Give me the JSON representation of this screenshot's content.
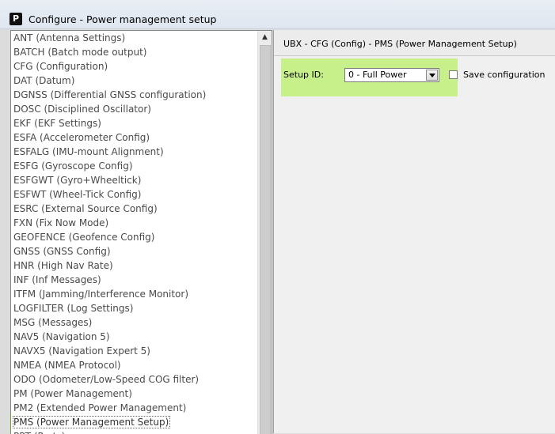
{
  "window": {
    "app_icon_letter": "P",
    "title": "Configure - Power management setup"
  },
  "message_list": {
    "items": [
      "ANT (Antenna Settings)",
      "BATCH (Batch mode output)",
      "CFG (Configuration)",
      "DAT (Datum)",
      "DGNSS (Differential GNSS configuration)",
      "DOSC (Disciplined Oscillator)",
      "EKF (EKF Settings)",
      "ESFA (Accelerometer Config)",
      "ESFALG (IMU-mount Alignment)",
      "ESFG (Gyroscope Config)",
      "ESFGWT (Gyro+Wheeltick)",
      "ESFWT (Wheel-Tick Config)",
      "ESRC (External Source Config)",
      "FXN (Fix Now Mode)",
      "GEOFENCE (Geofence Config)",
      "GNSS (GNSS Config)",
      "HNR (High Nav Rate)",
      "INF (Inf Messages)",
      "ITFM (Jamming/Interference Monitor)",
      "LOGFILTER (Log Settings)",
      "MSG (Messages)",
      "NAV5 (Navigation 5)",
      "NAVX5 (Navigation Expert 5)",
      "NMEA (NMEA Protocol)",
      "ODO (Odometer/Low-Speed COG filter)",
      "PM (Power Management)",
      "PM2 (Extended Power Management)",
      "PMS (Power Management Setup)",
      "PRT (Ports)"
    ],
    "selected": "PMS (Power Management Setup)",
    "scroll_up_glyph": "▲",
    "highlight_color": "#c8f08a"
  },
  "panel": {
    "title": "UBX - CFG (Config) - PMS (Power Management Setup)",
    "setup_id_label": "Setup ID:",
    "setup_id_value": "0 - Full Power",
    "save_config_label": "Save configuration",
    "save_config_checked": false,
    "highlight_color": "#c8f08a"
  }
}
